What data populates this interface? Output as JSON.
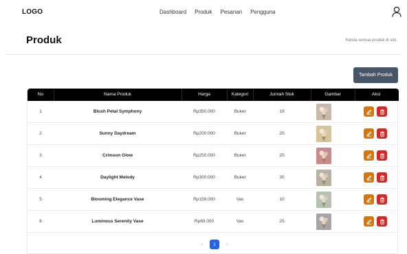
{
  "nav": {
    "logo": "LOGO",
    "links": [
      "Dashboard",
      "Produk",
      "Pesanan",
      "Pengguna"
    ]
  },
  "header": {
    "title": "Produk",
    "subtitle": "Kelola semua produk di sini."
  },
  "actions": {
    "add_label": "Tambah Produk"
  },
  "table": {
    "headers": [
      "No",
      "Nama Produk",
      "Harga",
      "Kategori",
      "Jumlah Stok",
      "Gambar",
      "Aksi"
    ],
    "rows": [
      {
        "no": "1",
        "name": "Blush Petal Symphony",
        "price": "Rp350.000",
        "category": "Buket",
        "stock": "19",
        "thumb_color": "#c9b9a8"
      },
      {
        "no": "2",
        "name": "Sunny Daydream",
        "price": "Rp200.000",
        "category": "Buket",
        "stock": "20",
        "thumb_color": "#d8c49a"
      },
      {
        "no": "3",
        "name": "Crimson Glow",
        "price": "Rp250.000",
        "category": "Buket",
        "stock": "20",
        "thumb_color": "#c98a8a"
      },
      {
        "no": "4",
        "name": "Daylight Melody",
        "price": "Rp300.000",
        "category": "Buket",
        "stock": "30",
        "thumb_color": "#b8b0a0"
      },
      {
        "no": "5",
        "name": "Blooming Elegance Vase",
        "price": "Rp159.000",
        "category": "Vas",
        "stock": "10",
        "thumb_color": "#b6c2b0"
      },
      {
        "no": "6",
        "name": "Luminous Serenity Vase",
        "price": "Rp89.000",
        "category": "Vas",
        "stock": "25",
        "thumb_color": "#a9a4a4"
      }
    ]
  },
  "pagination": {
    "prev": "‹",
    "current": "1",
    "next": "›"
  },
  "colors": {
    "header_bg": "#000000",
    "add_button": "#475569",
    "edit": "#d97706",
    "delete": "#dc2626",
    "active_page": "#2563eb"
  }
}
